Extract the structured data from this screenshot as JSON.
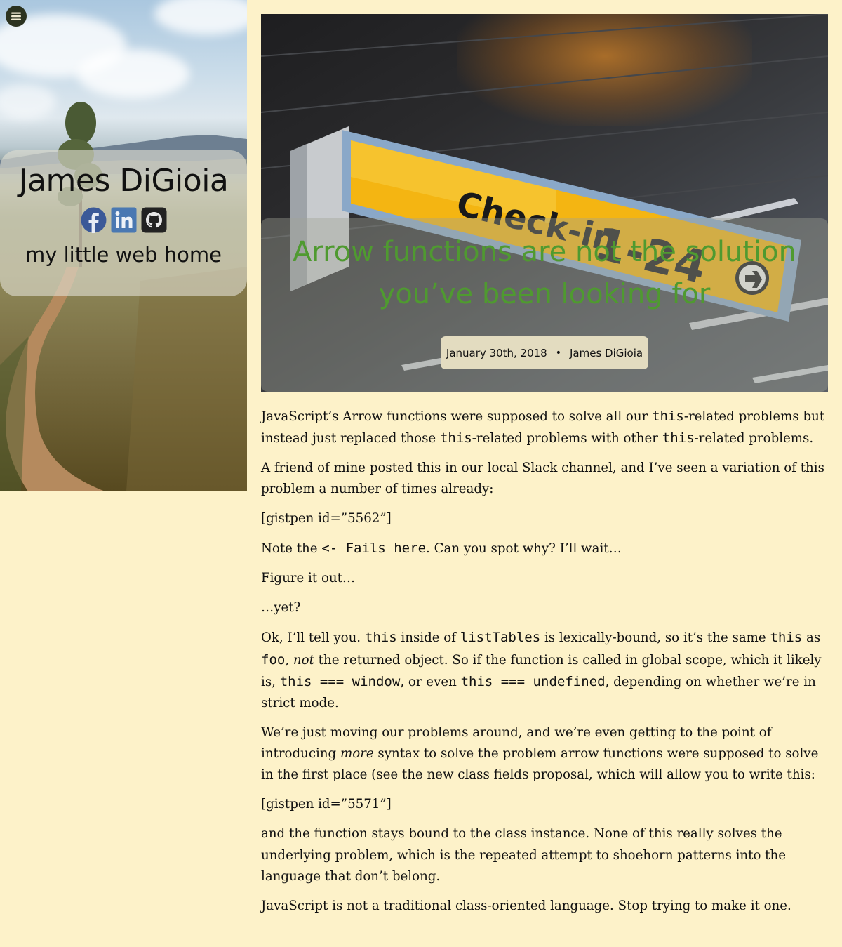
{
  "sidebar": {
    "name": "James DiGioia",
    "tagline": "my little web home",
    "social": [
      {
        "icon": "facebook-icon",
        "color": "#3b5998"
      },
      {
        "icon": "linkedin-icon",
        "color": "#4a78b2"
      },
      {
        "icon": "github-icon",
        "color": "#222222"
      }
    ]
  },
  "post": {
    "title": "Arrow functions are not the solution you’ve been looking for",
    "date": "January 30th, 2018",
    "separator": "•",
    "author": "James DiGioia",
    "hero_sign": {
      "main": "Check-in",
      "numbers": "1-24"
    }
  },
  "article": {
    "p1": {
      "a": "JavaScript’s Arrow functions were supposed to solve all our ",
      "c1": "this",
      "b": "-related problems but instead just replaced those ",
      "c2": "this",
      "c": "-related problems with other ",
      "c3": "this",
      "d": "-related problems."
    },
    "p2": "A friend of mine posted this in our local Slack channel, and I’ve seen a variation of this problem a number of times already:",
    "p3": "[gistpen id=”5562”]",
    "p4": {
      "a": "Note the ",
      "code": "<- Fails here",
      "b": ". Can you spot why? I’ll wait…"
    },
    "p5": "Figure it out…",
    "p6": "…yet?",
    "p7": {
      "a": "Ok, I’ll tell you. ",
      "c1": "this",
      "b": " inside of ",
      "c2": "listTables",
      "c": " is lexically-bound, so it’s the same ",
      "c3": "this",
      "d": " as ",
      "c4": "foo",
      "e": ", ",
      "em": "not",
      "f": " the returned object. So if the function is called in global scope, which it likely is, ",
      "c5": "this === window",
      "g": ", or even ",
      "c6": "this === undefined",
      "h": ", depending on whether we’re in strict mode."
    },
    "p8": {
      "a": "We’re just moving our problems around, and we’re even getting to the point of introducing ",
      "em": "more",
      "b": " syntax to solve the problem arrow functions were supposed to solve in the first place (see the new class fields proposal, which will allow you to write this:"
    },
    "p9": "[gistpen id=”5571”]",
    "p10": "and the function stays bound to the class instance. None of this really solves the underlying problem, which is the repeated attempt to shoehorn patterns into the language that don’t belong.",
    "p11": "JavaScript is not a traditional class-oriented language. Stop trying to make it one."
  },
  "colors": {
    "page_bg": "#fdf2c9",
    "title_green": "#4f9a30",
    "meta_bg": "#e3dcc0",
    "sign_yellow": "#f4b512"
  }
}
